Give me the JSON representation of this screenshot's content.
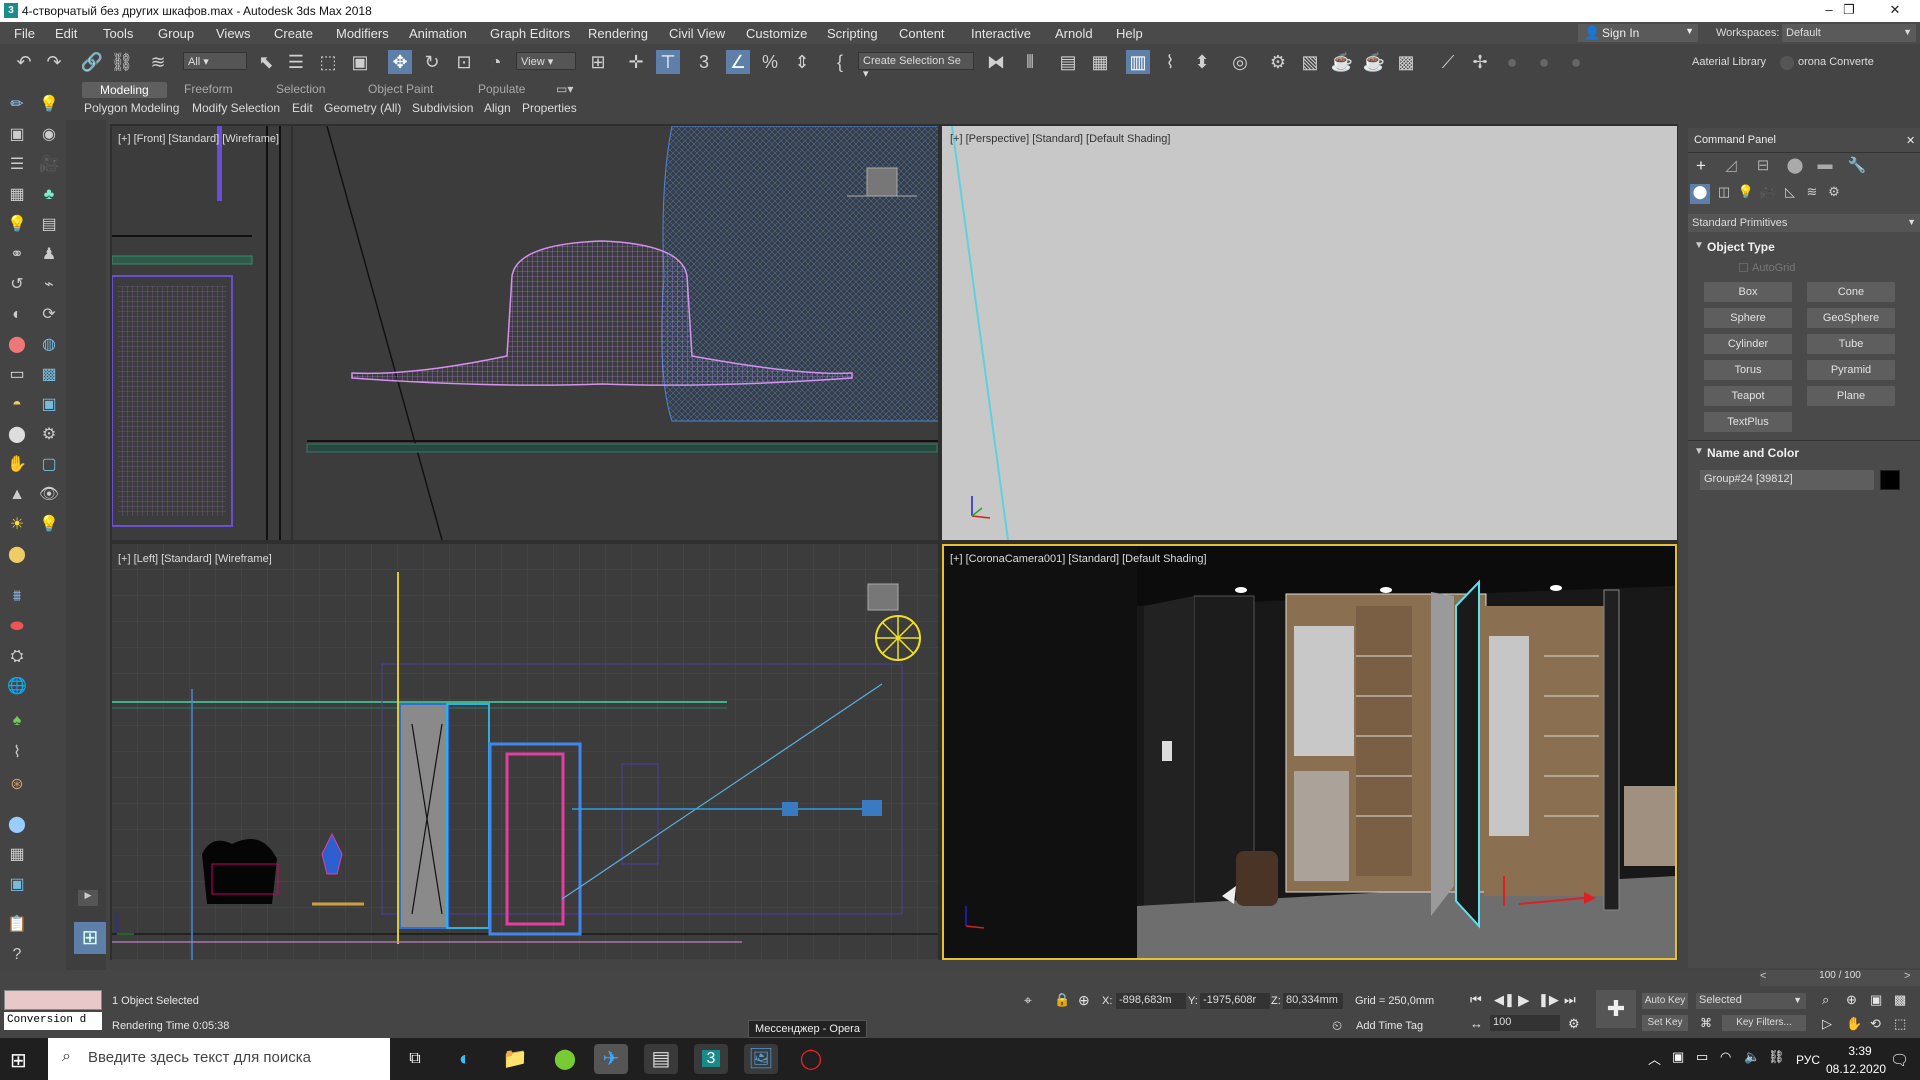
{
  "window": {
    "title": "4-створчатый без других шкафов.max - Autodesk 3ds Max 2018",
    "minimize": "–",
    "restore": "❐",
    "close": "✕"
  },
  "menu": [
    "File",
    "Edit",
    "Tools",
    "Group",
    "Views",
    "Create",
    "Modifiers",
    "Animation",
    "Graph Editors",
    "Rendering",
    "Civil View",
    "Customize",
    "Scripting",
    "Content",
    "Interactive",
    "Arnold",
    "Help"
  ],
  "account": {
    "sign_in": "Sign In",
    "workspaces_label": "Workspaces:",
    "workspace": "Default"
  },
  "toolbar": {
    "filter": "All",
    "ref_coord": "View",
    "selection_set": "Create Selection Se",
    "material_library": "Aaterial Library",
    "corona_converter": "orona Converte"
  },
  "ribbon": {
    "tabs": [
      "Modeling",
      "Freeform",
      "Selection",
      "Object Paint",
      "Populate"
    ],
    "subtabs": [
      "Polygon Modeling",
      "Modify Selection",
      "Edit",
      "Geometry (All)",
      "Subdivision",
      "Align",
      "Properties"
    ]
  },
  "viewports": {
    "front": "[+] [Front] [Standard] [Wireframe]",
    "perspective": "[+] [Perspective] [Standard] [Default Shading]",
    "left": "[+] [Left] [Standard] [Wireframe]",
    "camera": "[+] [CoronaCamera001] [Standard] [Default Shading]"
  },
  "command_panel": {
    "title": "Command Panel",
    "category": "Standard Primitives",
    "object_type": "Object Type",
    "autogrid": "AutoGrid",
    "buttons": [
      "Box",
      "Cone",
      "Sphere",
      "GeoSphere",
      "Cylinder",
      "Tube",
      "Torus",
      "Pyramid",
      "Teapot",
      "Plane",
      "TextPlus"
    ],
    "name_and_color": "Name and Color",
    "object_name": "Group#24 [39812]",
    "object_color": "#000000"
  },
  "status": {
    "selected": "1 Object Selected",
    "render_time": "Rendering Time  0:05:38",
    "script_box": "Conversion d",
    "x_label": "X:",
    "x": "-898,683m",
    "y_label": "Y:",
    "y": "-1975,608r",
    "z_label": "Z:",
    "z": "80,334mm",
    "grid": "Grid = 250,0mm",
    "add_time_tag": "Add Time Tag",
    "auto_key": "Auto Key",
    "set_key": "Set Key",
    "key_mode": "Selected",
    "key_filters": "Key Filters...",
    "frame": "100",
    "time_slider": "100 / 100",
    "tooltip": "Мессенджер - Opera"
  },
  "taskbar": {
    "search_placeholder": "Введите здесь текст для поиска",
    "lang": "РУС",
    "time": "3:39",
    "date": "08.12.2020"
  }
}
